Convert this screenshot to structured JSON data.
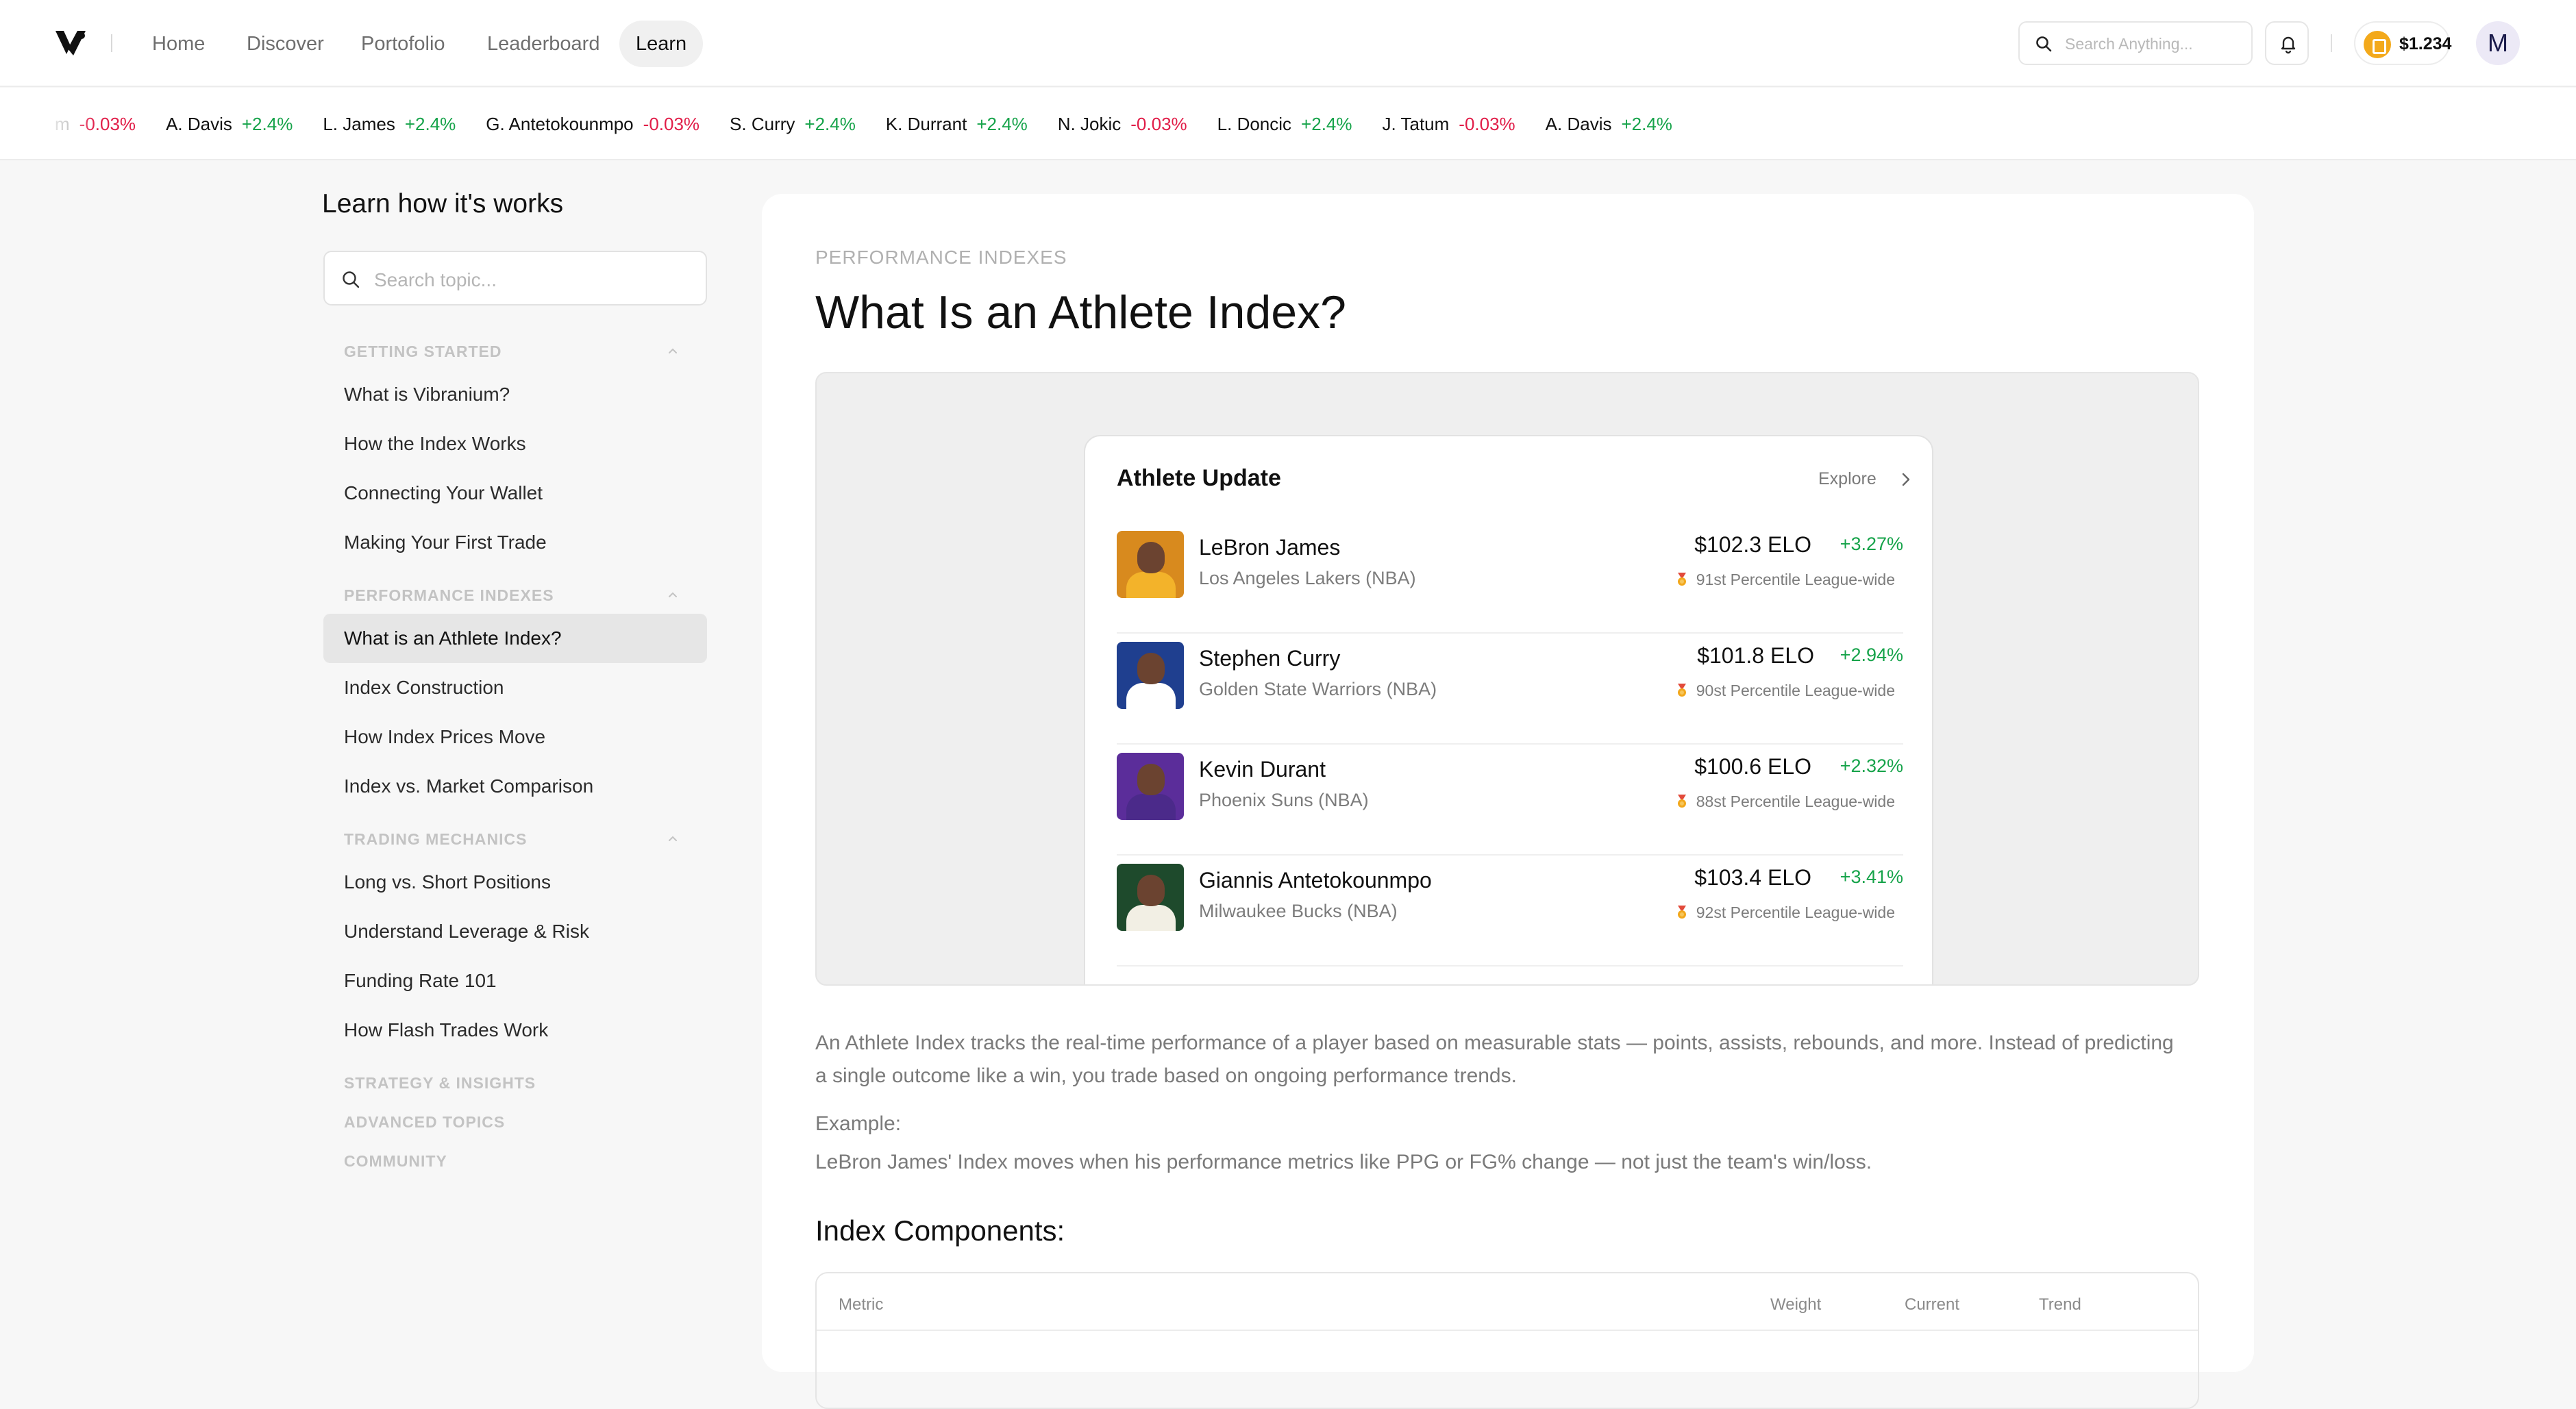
{
  "nav": {
    "items": [
      {
        "label": "Home",
        "active": false
      },
      {
        "label": "Discover",
        "active": false
      },
      {
        "label": "Portofolio",
        "active": false
      },
      {
        "label": "Leaderboard",
        "active": false
      },
      {
        "label": "Learn",
        "active": true
      }
    ],
    "search_placeholder": "Search Anything...",
    "wallet_amount": "$1.234",
    "avatar_initial": "M"
  },
  "ticker": [
    {
      "name": "",
      "change": "-0.03%",
      "direction": "down",
      "partial": "m"
    },
    {
      "name": "A. Davis",
      "change": "+2.4%",
      "direction": "up"
    },
    {
      "name": "L. James",
      "change": "+2.4%",
      "direction": "up"
    },
    {
      "name": "G. Antetokounmpo",
      "change": "-0.03%",
      "direction": "down"
    },
    {
      "name": "S. Curry",
      "change": "+2.4%",
      "direction": "up"
    },
    {
      "name": "K. Durrant",
      "change": "+2.4%",
      "direction": "up"
    },
    {
      "name": "N. Jokic",
      "change": "-0.03%",
      "direction": "down"
    },
    {
      "name": "L. Doncic",
      "change": "+2.4%",
      "direction": "up"
    },
    {
      "name": "J. Tatum",
      "change": "-0.03%",
      "direction": "down"
    },
    {
      "name": "A. Davis",
      "change": "+2.4%",
      "direction": "up"
    }
  ],
  "sidebar": {
    "title": "Learn how it's works",
    "search_placeholder": "Search topic...",
    "sections": [
      {
        "title": "GETTING STARTED",
        "expanded": true,
        "items": [
          "What is Vibranium?",
          "How the Index Works",
          "Connecting Your Wallet",
          "Making Your First Trade"
        ]
      },
      {
        "title": "PERFORMANCE INDEXES",
        "expanded": true,
        "items": [
          "What is an Athlete Index?",
          "Index Construction",
          "How Index Prices Move",
          "Index vs. Market Comparison"
        ]
      },
      {
        "title": "TRADING MECHANICS",
        "expanded": true,
        "items": [
          "Long vs. Short Positions",
          "Understand Leverage & Risk",
          "Funding Rate 101",
          "How Flash Trades Work"
        ]
      },
      {
        "title": "STRATEGY & INSIGHTS",
        "expanded": false,
        "items": []
      },
      {
        "title": "ADVANCED TOPICS",
        "expanded": false,
        "items": []
      },
      {
        "title": "COMMUNITY",
        "expanded": false,
        "items": []
      }
    ],
    "active_item": "What is an Athlete Index?"
  },
  "article": {
    "eyebrow": "PERFORMANCE INDEXES",
    "title": "What Is an Athlete Index?",
    "preview": {
      "title": "Athlete Update",
      "explore_label": "Explore",
      "athletes": [
        {
          "name": "LeBron James",
          "team": "Los Angeles Lakers (NBA)",
          "price": "$102.3 ELO",
          "change": "+3.27%",
          "percentile": "91st Percentile League-wide",
          "jersey_color": "#f3b32a",
          "bg_color": "#d88a1e"
        },
        {
          "name": "Stephen Curry",
          "team": "Golden State Warriors (NBA)",
          "price": "$101.8 ELO",
          "change": "+2.94%",
          "percentile": "90st Percentile League-wide",
          "jersey_color": "#ffffff",
          "bg_color": "#1f3f8f"
        },
        {
          "name": "Kevin Durant",
          "team": "Phoenix Suns (NBA)",
          "price": "$100.6 ELO",
          "change": "+2.32%",
          "percentile": "88st Percentile League-wide",
          "jersey_color": "#4b2a8a",
          "bg_color": "#5b2d9a"
        },
        {
          "name": "Giannis Antetokounmpo",
          "team": "Milwaukee Bucks (NBA)",
          "price": "$103.4 ELO",
          "change": "+3.41%",
          "percentile": "92st Percentile League-wide",
          "jersey_color": "#f2efe4",
          "bg_color": "#1e4a2c"
        }
      ]
    },
    "intro": "An Athlete Index tracks the real-time performance of a player based on measurable stats — points, assists, rebounds, and more. Instead of predicting a single outcome like a win, you trade based on ongoing performance trends.",
    "example_label": "Example:",
    "example_text": "LeBron James' Index moves when his performance metrics like PPG or FG% change — not just the team's win/loss.",
    "components_title": "Index Components:",
    "table": {
      "headers": [
        "Metric",
        "Weight",
        "Current",
        "Trend"
      ]
    }
  },
  "colors": {
    "up": "#16a34a",
    "down": "#e11d48",
    "accent_coin": "#f3a91b"
  }
}
